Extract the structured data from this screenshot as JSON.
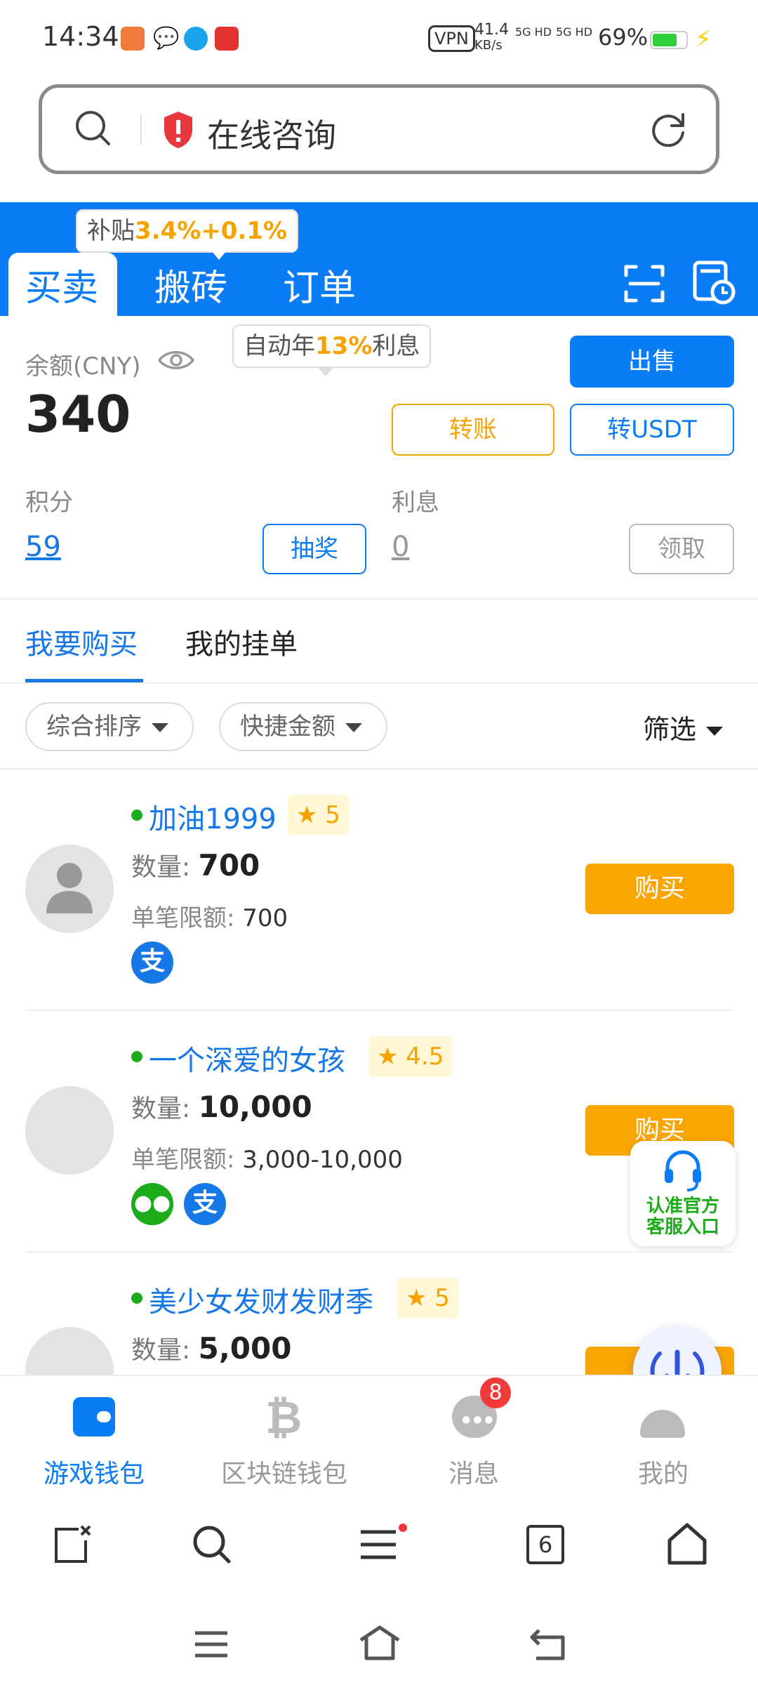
{
  "status_bar": {
    "time": "14:34",
    "vpn": "VPN",
    "speed": "41.4",
    "speed_unit": "KB/s",
    "net1": "5G HD",
    "net2": "5G HD",
    "battery": "69%"
  },
  "browser": {
    "url_text": "在线咨询"
  },
  "header": {
    "tabs": [
      "买卖",
      "搬砖",
      "订单"
    ],
    "active_tab": 0,
    "subsidy_label": "补贴",
    "subsidy_value": "3.4%+0.1%"
  },
  "balance": {
    "label": "余额(CNY)",
    "amount": "340",
    "interest_tip_prefix": "自动年",
    "interest_tip_value": "13%",
    "interest_tip_suffix": "利息",
    "sell_label": "出售",
    "transfer_label": "转账",
    "to_usdt_label": "转USDT",
    "points_label": "积分",
    "points_value": "59",
    "lottery_label": "抽奖",
    "interest_label": "利息",
    "interest_value": "0",
    "claim_label": "领取"
  },
  "market_tabs": [
    "我要购买",
    "我的挂单"
  ],
  "filters": {
    "sort_label": "综合排序",
    "amount_label": "快捷金额",
    "filter_label": "筛选"
  },
  "list_labels": {
    "qty_label": "数量:",
    "limit_label": "单笔限额:",
    "buy_label": "购买"
  },
  "listings": [
    {
      "name": "加油1999",
      "rating": "5",
      "qty": "700",
      "limit": "700",
      "pay": [
        "alipay"
      ]
    },
    {
      "name": "一个深爱的女孩",
      "rating": "4.5",
      "qty": "10,000",
      "limit": "3,000-10,000",
      "pay": [
        "wechat",
        "alipay"
      ]
    },
    {
      "name": "美少女发财发财季",
      "rating": "5",
      "qty": "5,000"
    }
  ],
  "service_float": {
    "line1": "认准官方",
    "line2": "客服入口"
  },
  "bottom_nav": {
    "items": [
      "游戏钱包",
      "区块链钱包",
      "消息",
      "我的"
    ],
    "active": 0,
    "message_badge": "8"
  },
  "browser_bar": {
    "tab_count": "6"
  },
  "colors": {
    "primary": "#0a7cf5",
    "accent": "#fba500",
    "online": "#1aad19"
  }
}
